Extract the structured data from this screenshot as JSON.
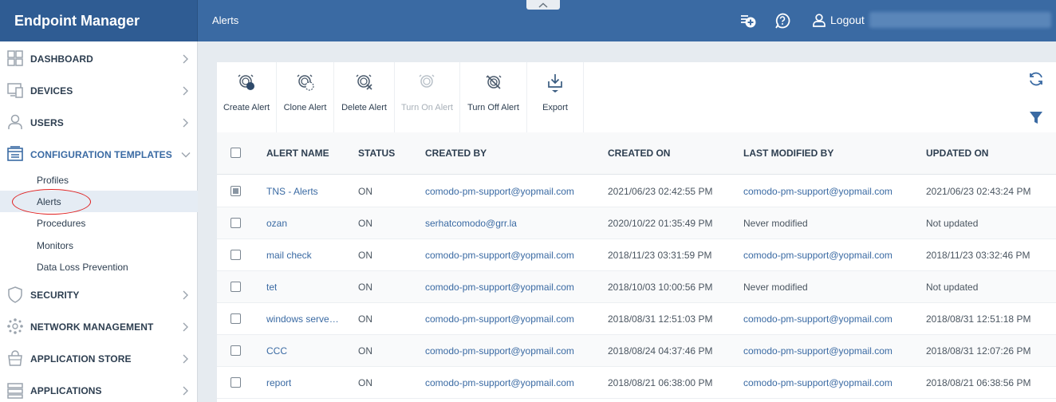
{
  "header": {
    "brand": "Endpoint Manager",
    "page_title": "Alerts",
    "logout_label": "Logout",
    "icons": [
      "add-task-icon",
      "help-icon",
      "user-icon"
    ]
  },
  "sidebar": {
    "items": [
      {
        "label": "DASHBOARD",
        "icon": "dashboard-icon"
      },
      {
        "label": "DEVICES",
        "icon": "devices-icon"
      },
      {
        "label": "USERS",
        "icon": "user-icon"
      },
      {
        "label": "CONFIGURATION TEMPLATES",
        "icon": "templates-icon",
        "expanded": true
      },
      {
        "label": "SECURITY",
        "icon": "shield-icon"
      },
      {
        "label": "NETWORK MANAGEMENT",
        "icon": "network-icon"
      },
      {
        "label": "APPLICATION STORE",
        "icon": "store-icon"
      },
      {
        "label": "APPLICATIONS",
        "icon": "applications-icon"
      }
    ],
    "sub_items": [
      "Profiles",
      "Alerts",
      "Procedures",
      "Monitors",
      "Data Loss Prevention"
    ],
    "selected_sub_item": "Alerts"
  },
  "toolbar": {
    "create": "Create Alert",
    "clone": "Clone Alert",
    "delete": "Delete Alert",
    "turn_on": "Turn On Alert",
    "turn_off": "Turn Off Alert",
    "export": "Export"
  },
  "table": {
    "columns": [
      "ALERT NAME",
      "STATUS",
      "CREATED BY",
      "CREATED ON",
      "LAST MODIFIED BY",
      "UPDATED ON"
    ],
    "rows": [
      {
        "name": "TNS - Alerts",
        "status": "ON",
        "created_by": "comodo-pm-support@yopmail.com",
        "created_on": "2021/06/23 02:42:55 PM",
        "modified_by": "comodo-pm-support@yopmail.com",
        "updated_on": "2021/06/23 02:43:24 PM",
        "checked": true
      },
      {
        "name": "ozan",
        "status": "ON",
        "created_by": "serhatcomodo@grr.la",
        "created_on": "2020/10/22 01:35:49 PM",
        "modified_by": "Never modified",
        "updated_on": "Not updated",
        "checked": false
      },
      {
        "name": "mail check",
        "status": "ON",
        "created_by": "comodo-pm-support@yopmail.com",
        "created_on": "2018/11/23 03:31:59 PM",
        "modified_by": "comodo-pm-support@yopmail.com",
        "updated_on": "2018/11/23 03:32:46 PM",
        "checked": false
      },
      {
        "name": "tet",
        "status": "ON",
        "created_by": "comodo-pm-support@yopmail.com",
        "created_on": "2018/10/03 10:00:56 PM",
        "modified_by": "Never modified",
        "updated_on": "Not updated",
        "checked": false
      },
      {
        "name": "windows serve…",
        "status": "ON",
        "created_by": "comodo-pm-support@yopmail.com",
        "created_on": "2018/08/31 12:51:03 PM",
        "modified_by": "comodo-pm-support@yopmail.com",
        "updated_on": "2018/08/31 12:51:18 PM",
        "checked": false
      },
      {
        "name": "CCC",
        "status": "ON",
        "created_by": "comodo-pm-support@yopmail.com",
        "created_on": "2018/08/24 04:37:46 PM",
        "modified_by": "comodo-pm-support@yopmail.com",
        "updated_on": "2018/08/31 12:07:26 PM",
        "checked": false
      },
      {
        "name": "report",
        "status": "ON",
        "created_by": "comodo-pm-support@yopmail.com",
        "created_on": "2018/08/21 06:38:00 PM",
        "modified_by": "comodo-pm-support@yopmail.com",
        "updated_on": "2018/08/21 06:38:56 PM",
        "checked": false
      }
    ]
  },
  "colors": {
    "header": "#3a6aa3",
    "brand": "#2f5c93",
    "link": "#3a6aa3",
    "highlight_circle": "#e02020"
  }
}
